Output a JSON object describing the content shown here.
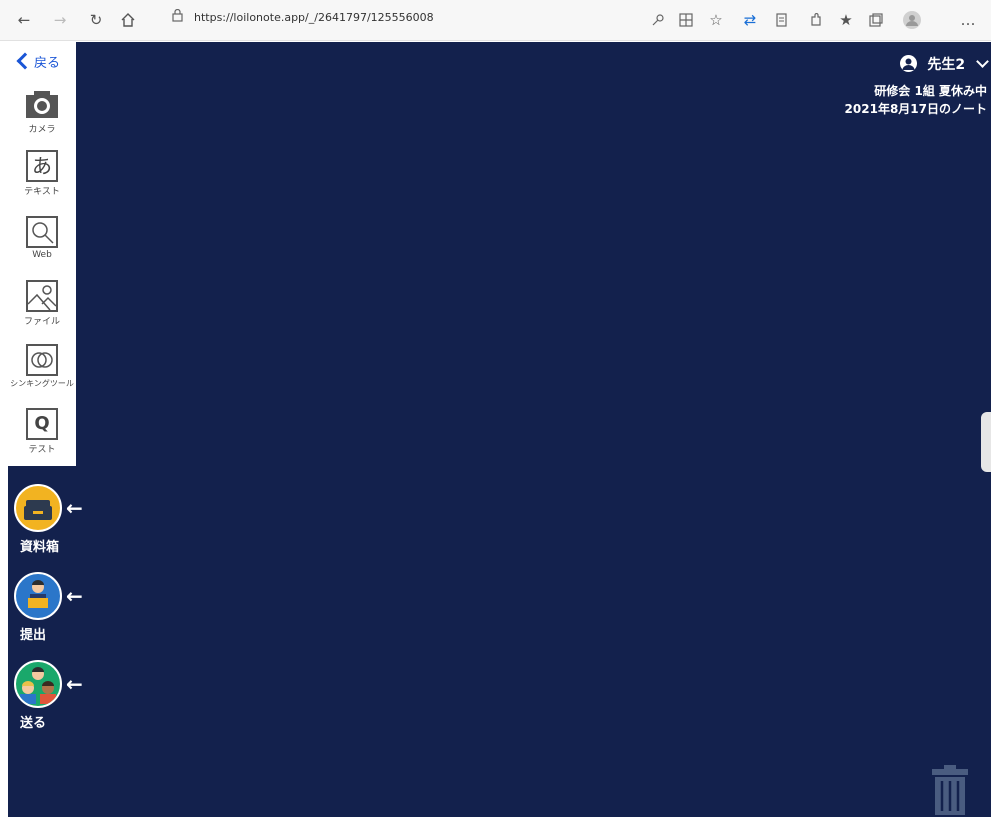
{
  "browser": {
    "url": "https://loilonote.app/_/2641797/125556008",
    "back_icon": "arrow-left-icon",
    "forward_icon": "arrow-right-icon",
    "refresh_icon": "refresh-icon",
    "home_icon": "home-icon",
    "more_label": "…"
  },
  "sidebar": {
    "back_label": "戻る",
    "tools": [
      {
        "label": "カメラ",
        "icon": "camera-icon"
      },
      {
        "label": "テキスト",
        "icon": "text-icon",
        "glyph": "あ"
      },
      {
        "label": "Web",
        "icon": "web-search-icon"
      },
      {
        "label": "ファイル",
        "icon": "image-file-icon"
      },
      {
        "label": "シンキングツール",
        "icon": "thinking-tool-icon"
      },
      {
        "label": "テスト",
        "icon": "test-icon",
        "glyph": "Q"
      }
    ]
  },
  "actions": [
    {
      "label": "資料箱",
      "icon": "document-box-icon",
      "color": "#f2b321"
    },
    {
      "label": "提出",
      "icon": "submit-icon",
      "color": "#2b76c9"
    },
    {
      "label": "送る",
      "icon": "send-icon",
      "color": "#1aa86b"
    }
  ],
  "header": {
    "user_name": "先生2",
    "class_line": "研修会 1組 夏休み中",
    "note_date": "2021年8月17日のノート"
  },
  "colors": {
    "canvas": "#13214d",
    "accent": "#1a55d6"
  }
}
